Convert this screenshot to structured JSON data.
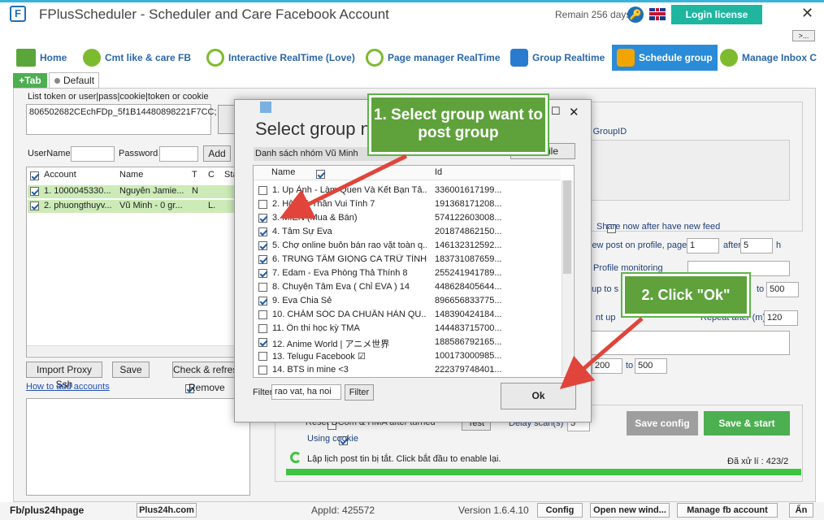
{
  "window": {
    "title": "FPlusScheduler - Scheduler and Care Facebook Account",
    "remain": "Remain 256 days",
    "login_label": "Login license",
    "close": "✕",
    "more": ">..."
  },
  "nav": {
    "tabs": [
      {
        "label": "Home",
        "icon": "home-icon"
      },
      {
        "label": "Cmt like & care FB",
        "icon": "people-icon"
      },
      {
        "label": "Interactive RealTime (Love)",
        "icon": "clock-icon"
      },
      {
        "label": "Page manager RealTime",
        "icon": "clock-icon"
      },
      {
        "label": "Group Realtime",
        "icon": "group-icon"
      },
      {
        "label": "Schedule group",
        "icon": "group-icon",
        "active": true
      },
      {
        "label": "Manage Inbox C",
        "icon": "chat-icon"
      }
    ]
  },
  "left": {
    "add_tab": "+Tab",
    "default_tab": "Default",
    "token_label": "List token or user|pass|cookie|token or cookie",
    "token_value": "806502682CEchFDp_5f1B14480898221F7CC;",
    "username_label": "UserName",
    "password_label": "Password",
    "add_button": "Add",
    "table": {
      "headers": [
        "Account",
        "Name",
        "T",
        "C",
        "Sta"
      ],
      "rows": [
        {
          "account": "1. 1000045330...",
          "name": "Nguyễn Jamie...",
          "t": "N",
          "c": ""
        },
        {
          "account": "2. phuongthuyv...",
          "name": "Vũ Minh - 0 gr...",
          "t": "",
          "c": "L."
        }
      ]
    },
    "import_button": "Import Proxy Ssh",
    "save_button": "Save",
    "check_button": "Check & refresh",
    "howto": "How to add accounts",
    "remove_label": "Remove"
  },
  "right": {
    "share_label": "Share now after have new feed",
    "new_post_label": "iew post on profile, page",
    "after_label": "after",
    "hours": "h",
    "new_post_value": "1",
    "after_value": "5",
    "profile_monitoring": "Profile monitoring",
    "to": "to",
    "to_value": "500",
    "repeat_label": "Repeat after (m)",
    "repeat_value": "120",
    "range_from": "200",
    "range_to": "500",
    "reset_label": "Reset DCom & HMA after turned",
    "test_button": "Test",
    "delay_label": "Delay scan(s)",
    "delay_value": "5",
    "using_cookie": "Using cookie",
    "save_config": "Save config",
    "save_start": "Save & start",
    "status": "Lập lịch post tin bị tắt. Click bắt đầu to enable lại.",
    "processed": "Đã xử lí : 423/2",
    "groupid_hint": "st GroupID",
    "up_label": "nt up",
    "gto_label": "oup to s"
  },
  "dialog": {
    "title": "Select group n",
    "subtitle": "Danh sách nhóm Vũ Minh",
    "file_button": "ile",
    "headers": [
      "Name",
      "Id"
    ],
    "rows": [
      {
        "name": "1. Up Ảnh - Làm Quen Và Kết Bạn Tâ...",
        "id": "336001617199...",
        "checked": false
      },
      {
        "name": "2. Hội Độ Thần Vui Tính 7",
        "id": "191368171208...",
        "checked": false
      },
      {
        "name": "3. MIỀN (Mua & Bán)",
        "id": "574122603008...",
        "checked": true
      },
      {
        "name": "4. Tâm Sự Eva",
        "id": "201874862150...",
        "checked": true
      },
      {
        "name": "5. Chợ online buôn bán rao vặt toàn q...",
        "id": "146132312592...",
        "checked": true
      },
      {
        "name": "6. TRUNG TÂM GIỌNG CA TRỮ TÌNH",
        "id": "183731087659...",
        "checked": true
      },
      {
        "name": "7. Edam - Eva Phòng Thả Thính 8",
        "id": "255241941789...",
        "checked": true
      },
      {
        "name": "8. Chuyện Tâm Eva ( Chỉ EVA ) 14",
        "id": "448628405644...",
        "checked": false
      },
      {
        "name": "9. Eva Chia Sẻ",
        "id": "896656833775...",
        "checked": true
      },
      {
        "name": "10. CHĂM SÓC DA CHUẨN HÀN QU...",
        "id": "148390424184...",
        "checked": false
      },
      {
        "name": "11. Ôn thi học kỳ TMA",
        "id": "144483715700...",
        "checked": false
      },
      {
        "name": "12. Anime World | アニメ世界",
        "id": "188586792165...",
        "checked": true
      },
      {
        "name": "13. Telugu Facebook ☑",
        "id": "100173000985...",
        "checked": false
      },
      {
        "name": "14. BTS in mine <3",
        "id": "222379748401...",
        "checked": false
      }
    ],
    "filter_label": "Filter",
    "filter_value": "rao vat, ha noi",
    "filter_button": "Filter",
    "ok_button": "Ok"
  },
  "callouts": {
    "step1": "1. Select group want to post group",
    "step2": "2. Click \"Ok\""
  },
  "bottom": {
    "fb": "Fb/plus24hpage",
    "site": "Plus24h.com",
    "appid": "AppId: 425572",
    "version": "Version 1.6.4.10",
    "config": "Config",
    "open_new": "Open new wind...",
    "manage": "Manage fb account",
    "hide": "Ẩn"
  },
  "colors": {
    "accent": "#2a8bd8",
    "green": "#4caf50",
    "login": "#1fb6a0",
    "callout": "#5fa23c",
    "arrow": "#e0443a"
  }
}
